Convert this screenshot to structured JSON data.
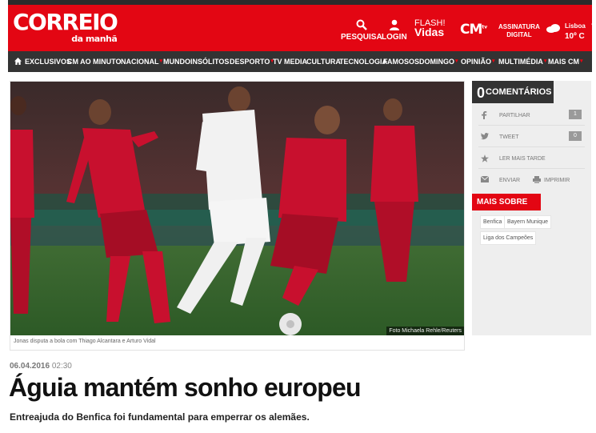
{
  "header": {
    "logo_main": "CORREIO",
    "logo_sub": "da manhã",
    "search_label": "PESQUISA",
    "login_label": "LOGIN",
    "flash_top": "FLASH!",
    "flash_bottom": "Vidas",
    "cm_logo": "CM",
    "cm_tv": "tv",
    "assinatura_line1": "ASSINATURA",
    "assinatura_line2": "DIGITAL",
    "weather_city": "Lisboa",
    "weather_temp": "10º C",
    "brand_color": "#e30613"
  },
  "nav": {
    "items": [
      {
        "label": "EXCLUSIVOS",
        "caret": false
      },
      {
        "label": "CM AO MINUTO",
        "caret": false
      },
      {
        "label": "NACIONAL",
        "caret": true
      },
      {
        "label": "MUNDO",
        "caret": false
      },
      {
        "label": "INSÓLITOS",
        "caret": false
      },
      {
        "label": "DESPORTO",
        "caret": true
      },
      {
        "label": "TV MEDIA",
        "caret": false
      },
      {
        "label": "CULTURA",
        "caret": false
      },
      {
        "label": "TECNOLOGIA",
        "caret": false
      },
      {
        "label": "FAMOSOS",
        "caret": false
      },
      {
        "label": "DOMINGO",
        "caret": true
      },
      {
        "label": "OPINIÃO",
        "caret": true
      },
      {
        "label": "MULTIMÉDIA",
        "caret": true
      },
      {
        "label": "MAIS CM",
        "caret": true
      }
    ]
  },
  "photo": {
    "credit": "Foto Michaela Rehle/Reuters",
    "caption": "Jonas disputa a bola com Thiago Alcantara e Arturo Vidal"
  },
  "sidebar": {
    "comments_count": "0",
    "comments_label": "COMENTÁRIOS",
    "share_label": "PARTILHAR",
    "share_count": "1",
    "tweet_label": "TWEET",
    "tweet_count": "0",
    "read_later_label": "LER MAIS TARDE",
    "send_label": "ENVIAR",
    "print_label": "IMPRIMIR",
    "mais_sobre_label": "MAIS SOBRE",
    "tags": [
      "Benfica",
      "Bayern Munique",
      "Liga dos Campeões"
    ]
  },
  "article": {
    "date": "06.04.2016",
    "time": "02:30",
    "title": "Águia mantém sonho europeu",
    "lead": "Entreajuda do Benfica foi fundamental para emperrar os alemães."
  }
}
